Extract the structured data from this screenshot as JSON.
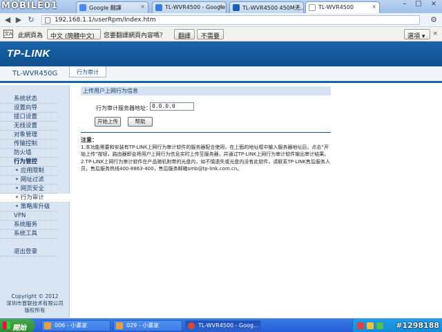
{
  "watermark_logo": "MOBILE01",
  "browser": {
    "tabs": [
      {
        "label": "Google 翻譯",
        "color": "#4a8ae8"
      },
      {
        "label": "TL-WVR4500 - Google",
        "color": "#3b7de0"
      },
      {
        "label": "TL-WVR4500 450M无...",
        "color": "#1b5fb0"
      },
      {
        "label": "TL-WVR4500",
        "color": "#bbbbbb"
      }
    ],
    "url": "192.168.1.1/userRpm/Index.htm"
  },
  "translate_bar": {
    "text_before": "此網頁為",
    "language": "中文 (簡體中文)",
    "question": "您要翻譯網頁內容嗎？",
    "translate_button": "翻譯",
    "no_button": "不需要",
    "options_button": "選項"
  },
  "router": {
    "logo": "TP-LINK",
    "model": "TL-WVR450G",
    "page_tab": "行为审计"
  },
  "sidebar": {
    "items": [
      {
        "label": "系统状态",
        "kind": "item"
      },
      {
        "label": "设置向导",
        "kind": "item"
      },
      {
        "label": "接口设置",
        "kind": "item"
      },
      {
        "label": "无线设置",
        "kind": "item"
      },
      {
        "label": "对象管理",
        "kind": "item"
      },
      {
        "label": "传输控制",
        "kind": "item"
      },
      {
        "label": "防火墙",
        "kind": "item"
      },
      {
        "label": "行为管控",
        "kind": "group"
      },
      {
        "label": "• 应用限制",
        "kind": "sub"
      },
      {
        "label": "• 网址过滤",
        "kind": "sub"
      },
      {
        "label": "• 网页安全",
        "kind": "sub"
      },
      {
        "label": "• 行为审计",
        "kind": "sub-active"
      },
      {
        "label": "• 策略库升级",
        "kind": "sub"
      },
      {
        "label": "VPN",
        "kind": "item"
      },
      {
        "label": "系统服务",
        "kind": "item"
      },
      {
        "label": "系统工具",
        "kind": "item"
      },
      {
        "label": "",
        "kind": "gap"
      },
      {
        "label": "退出登录",
        "kind": "item"
      }
    ],
    "copyright_line1": "Copyright © 2012",
    "copyright_line2": "深圳市普联技术有限公司",
    "copyright_line3": "版权所有"
  },
  "main": {
    "section_title": "上传用户上网行为信息",
    "server_label": "行为审计服务器地址：",
    "server_value": "0.0.0.0",
    "start_upload_button": "开始上传",
    "help_button": "帮助",
    "note_title": "注意：",
    "note_1": "1.本功能需要和安装有TP-LINK上网行为审计软件的服务器配合使用，在上面的地址框中输入服务器地址后，点击“开始上传”按钮，路由器即会将用户上网行为信息实时上传至服务器，并通过TP-LINK上网行为审计软件输出审计结果。",
    "note_2": "2.TP-LINK上网行为审计软件在产品随机附带的光盘内，如不慎遗失或光盘内没有此软件，请联系TP-LINK售后服务人员，售后服务热线400-8863-400，售后服务邮箱smb@tp-link.com.cn。"
  },
  "taskbar": {
    "start_label": "開始",
    "tasks": [
      {
        "label": "006 - 小畫家",
        "color": "#e8a040"
      },
      {
        "label": "029 - 小畫家",
        "color": "#e8a040"
      },
      {
        "label": "TL-WVR4500 - Goog...",
        "color": "#dd4433"
      }
    ],
    "watermark_id": "#1298188"
  }
}
